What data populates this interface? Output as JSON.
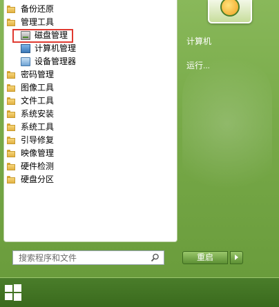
{
  "programs": [
    {
      "label": "备份还原",
      "icon": "folder-icon"
    },
    {
      "label": "管理工具",
      "icon": "folder-icon"
    },
    {
      "label": "磁盘管理",
      "icon": "disk-management-icon",
      "sub": true,
      "highlighted": true
    },
    {
      "label": "计算机管理",
      "icon": "computer-management-icon",
      "sub": true
    },
    {
      "label": "设备管理器",
      "icon": "device-manager-icon",
      "sub": true
    },
    {
      "label": "密码管理",
      "icon": "folder-icon"
    },
    {
      "label": "图像工具",
      "icon": "folder-icon"
    },
    {
      "label": "文件工具",
      "icon": "folder-icon"
    },
    {
      "label": "系统安装",
      "icon": "folder-icon"
    },
    {
      "label": "系统工具",
      "icon": "folder-icon"
    },
    {
      "label": "引导修复",
      "icon": "folder-icon"
    },
    {
      "label": "映像管理",
      "icon": "folder-icon"
    },
    {
      "label": "硬件检测",
      "icon": "folder-icon"
    },
    {
      "label": "硬盘分区",
      "icon": "folder-icon"
    }
  ],
  "search": {
    "placeholder": "搜索程序和文件",
    "icon": "search-icon"
  },
  "right": {
    "computer": "计算机",
    "run": "运行..."
  },
  "shutdown": {
    "label": "重启"
  },
  "colors": {
    "accent_green": "#79ab4a",
    "highlight_border": "#e0392f",
    "taskbar": "#3a6a1d"
  }
}
